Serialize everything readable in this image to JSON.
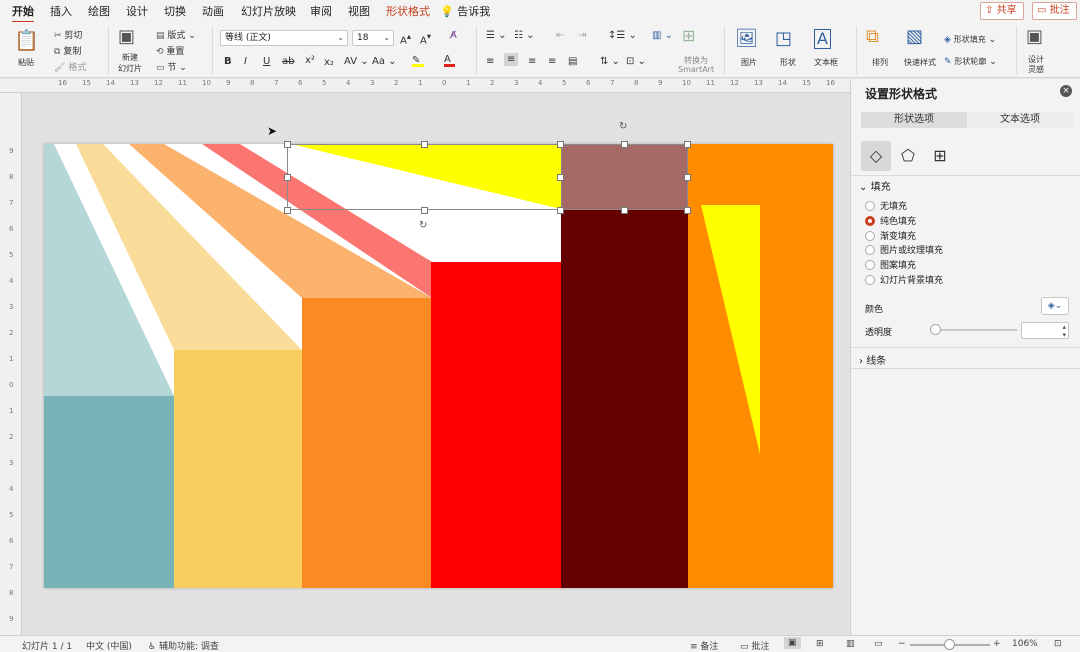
{
  "tabs": [
    {
      "label": "开始",
      "active": true
    },
    {
      "label": "插入"
    },
    {
      "label": "绘图"
    },
    {
      "label": "设计"
    },
    {
      "label": "切换"
    },
    {
      "label": "动画"
    },
    {
      "label": "幻灯片放映"
    },
    {
      "label": "审阅"
    },
    {
      "label": "视图"
    },
    {
      "label": "形状格式",
      "contextual": true
    },
    {
      "label": "告诉我"
    }
  ],
  "top_buttons": {
    "share": "共享",
    "comment": "批注"
  },
  "ribbon": {
    "paste": "粘贴",
    "cut": "剪切",
    "copy": "复制",
    "format_painter": "格式",
    "new_slide_line1": "新建",
    "new_slide_line2": "幻灯片",
    "layout": "版式",
    "reset": "重置",
    "section": "节",
    "font_name": "等线 (正文)",
    "font_size": "18",
    "bold": "B",
    "italic": "I",
    "underline": "U",
    "strike": "ab",
    "superscript": "x²",
    "subscript": "x₂",
    "char_spacing": "AV",
    "change_case": "Aa",
    "convert_smartart_line1": "转换为",
    "convert_smartart_line2": "SmartArt",
    "picture": "图片",
    "shape": "形状",
    "textbox": "文本框",
    "arrange": "排列",
    "quick_styles": "快速样式",
    "shape_fill": "形状填充",
    "shape_outline": "形状轮廓",
    "designer_line1": "设计",
    "designer_line2": "灵感"
  },
  "ruler_numbers": [
    "16",
    "15",
    "14",
    "13",
    "12",
    "11",
    "10",
    "9",
    "8",
    "7",
    "6",
    "5",
    "4",
    "3",
    "2",
    "1",
    "0",
    "1",
    "2",
    "3",
    "4",
    "5",
    "6",
    "7",
    "8",
    "9",
    "10",
    "11",
    "12",
    "13",
    "14",
    "15",
    "16"
  ],
  "vruler_numbers": [
    "9",
    "8",
    "7",
    "6",
    "5",
    "4",
    "3",
    "2",
    "1",
    "0",
    "1",
    "2",
    "3",
    "4",
    "5",
    "6",
    "7",
    "8",
    "9"
  ],
  "slide": {
    "colors": {
      "white": "#ffffff",
      "teal_light": "#b5d7d8",
      "teal": "#78b3b8",
      "wheat": "#f9dc9a",
      "gold": "#f9cd60",
      "peach": "#fbb26c",
      "orange": "#fb8a24",
      "salmon": "#fb7670",
      "red": "#fe0000",
      "maroon": "#660000",
      "mauve": "#a56a66",
      "yellow": "#ffff00",
      "bright_orange": "#ff8c00"
    }
  },
  "pane": {
    "title": "设置形状格式",
    "tab_shape": "形状选项",
    "tab_text": "文本选项",
    "fill_section": "填充",
    "fill_options": [
      "无填充",
      "纯色填充",
      "渐变填充",
      "图片或纹理填充",
      "图案填充",
      "幻灯片背景填充"
    ],
    "selected_fill": 1,
    "color_label": "颜色",
    "transparency_label": "透明度",
    "line_section": "线条"
  },
  "status": {
    "slide_count": "幻灯片 1 / 1",
    "language": "中文 (中国)",
    "accessibility": "辅助功能: 调查",
    "notes": "备注",
    "comments": "批注",
    "zoom": "106%"
  }
}
